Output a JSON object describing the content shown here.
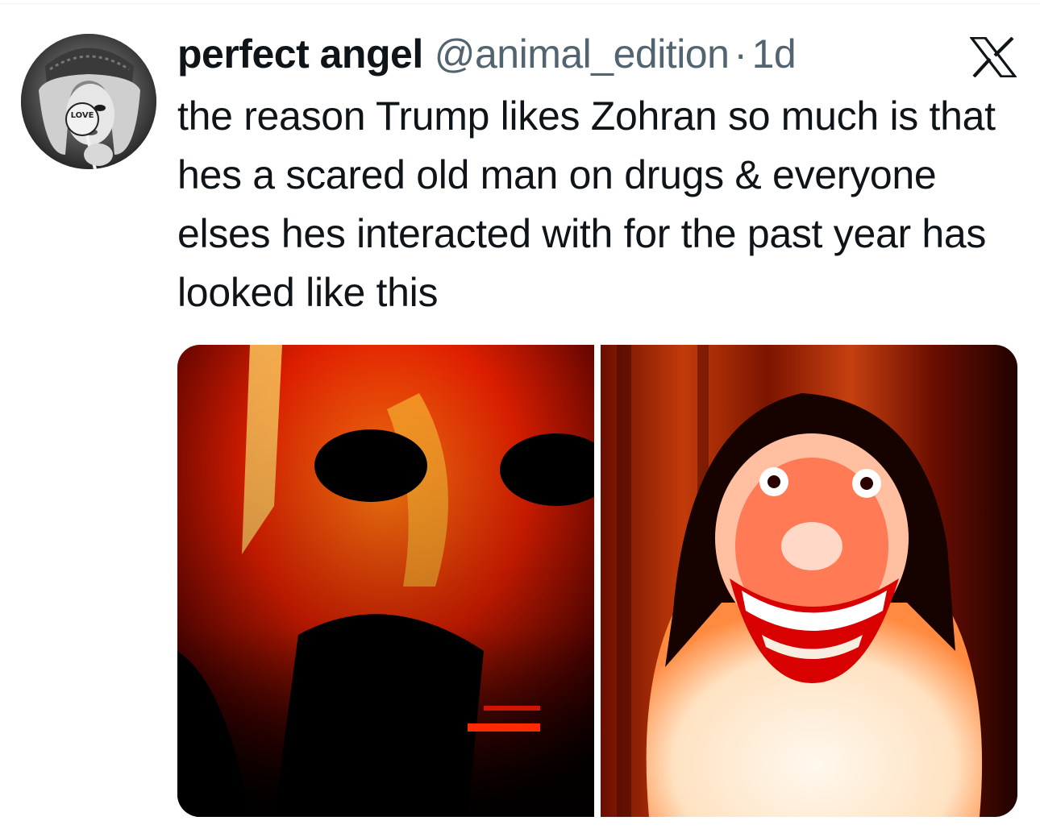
{
  "tweet": {
    "display_name": "perfect angel",
    "handle": "@animal_edition",
    "separator": "·",
    "time": "1d",
    "text": "the reason Trump likes Zohran so much is that hes a scared old man on drugs & everyone elses hes interacted with for the past year has looked like this",
    "avatar_caption": "LOVE"
  },
  "icons": {
    "platform": "x-logo-icon",
    "avatar": "profile-avatar",
    "media_left": "distorted-face-image",
    "media_right": "grinning-dog-image"
  },
  "colors": {
    "text_primary": "#0f1419",
    "text_secondary": "#536471",
    "divider": "#eff3f4"
  }
}
